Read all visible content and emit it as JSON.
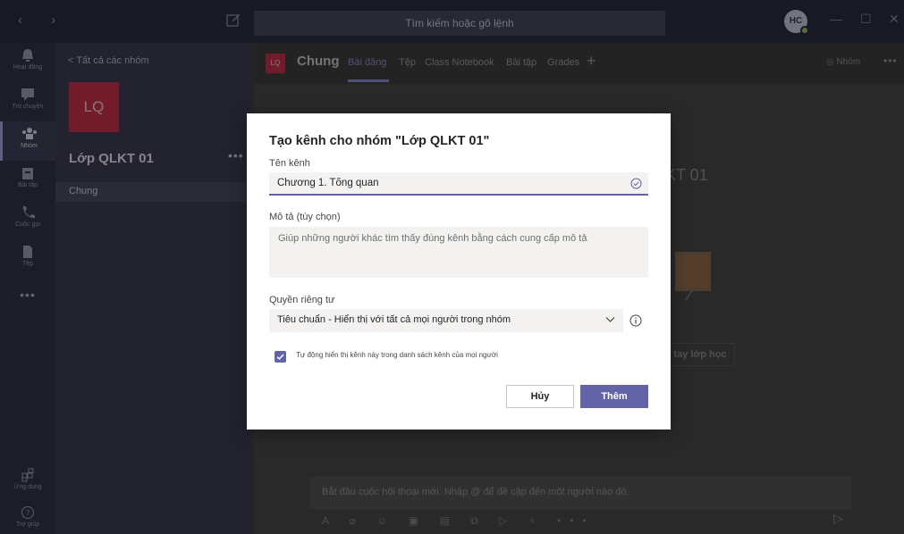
{
  "titlebar": {
    "search_placeholder": "Tìm kiếm hoặc gõ lệnh",
    "avatar_initials": "HC",
    "controls": [
      "—",
      "☐",
      "✕"
    ]
  },
  "rail": {
    "items": [
      {
        "label": "Hoạt động",
        "icon": "bell-icon"
      },
      {
        "label": "Trò chuyện",
        "icon": "chat-icon"
      },
      {
        "label": "Nhóm",
        "icon": "teams-icon",
        "active": true
      },
      {
        "label": "Bài tập",
        "icon": "assignments-icon"
      },
      {
        "label": "Cuộc gọi",
        "icon": "phone-icon"
      },
      {
        "label": "Tệp",
        "icon": "file-icon"
      }
    ],
    "more": "•••",
    "bottom": [
      {
        "label": "Ứng dụng",
        "icon": "apps-icon"
      },
      {
        "label": "Trợ giúp",
        "icon": "help-icon"
      }
    ]
  },
  "leftpanel": {
    "back_label": "<  Tất cả các nhóm",
    "team_avatar": "LQ",
    "team_name": "Lớp QLKT 01",
    "more": "•••",
    "channels": [
      "Chung"
    ]
  },
  "channel_header": {
    "avatar": "LQ",
    "title": "Chung",
    "tabs": [
      "Bài đăng",
      "Tệp",
      "Class Notebook",
      "Bài tập",
      "Grades"
    ],
    "add": "+",
    "team_button": "◎ Nhóm",
    "more": "•••"
  },
  "background": {
    "welcome_text": "KT 01",
    "ghost_button": "tay lớp học"
  },
  "composer": {
    "placeholder": "Bắt đầu cuộc hội thoại mới. Nhập @ để đề cập đến một người nào đó.",
    "tools": "A   ⌀  ☺  ▣  ▤  ⧉  ▷  ♀  •••",
    "send": "▷"
  },
  "dialog": {
    "title": "Tạo kênh cho nhóm \"Lớp QLKT 01\"",
    "name_label": "Tên kênh",
    "name_value": "Chương 1. Tổng quan",
    "desc_label": "Mô tả (tùy chọn)",
    "desc_placeholder": "Giúp những người khác tìm thấy đúng kênh bằng cách cung cấp mô tả",
    "privacy_label": "Quyền riêng tư",
    "privacy_value": "Tiêu chuẩn - Hiển thị với tất cả mọi người trong nhóm",
    "auto_show_label": "Tự động hiển thị kênh này trong danh sách kênh của mọi người",
    "auto_show_checked": true,
    "cancel_label": "Hủy",
    "add_label": "Thêm"
  },
  "colors": {
    "accent": "#6264a7",
    "team_red": "#c4314b",
    "titlebar": "#2b2b40",
    "rail": "#323247"
  }
}
